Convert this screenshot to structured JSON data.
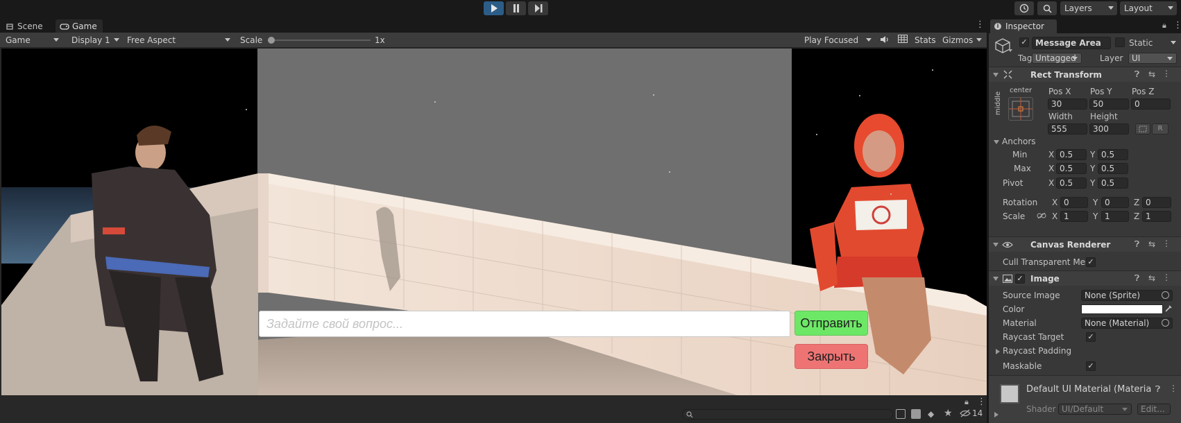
{
  "toolbar": {
    "right": {
      "history_icon": "history-icon",
      "search_icon": "search-icon",
      "layers": "Layers",
      "layout": "Layout"
    }
  },
  "game_panel": {
    "tabs": [
      {
        "label": "Scene"
      },
      {
        "label": "Game"
      }
    ],
    "toolbar": {
      "mode": "Game",
      "display": "Display 1",
      "aspect": "Free Aspect",
      "scale_label": "Scale",
      "scale_value": "1x",
      "play_focused": "Play Focused",
      "stats": "Stats",
      "gizmos": "Gizmos"
    },
    "viewport": {
      "input_placeholder": "Задайте свой вопрос...",
      "send_button": "Отправить",
      "close_button": "Закрыть"
    },
    "status": {
      "count": "14"
    }
  },
  "inspector": {
    "tab": "Inspector",
    "object": {
      "active": true,
      "name": "Message Area",
      "static_label": "Static",
      "tag_label": "Tag",
      "tag": "Untagged",
      "layer_label": "Layer",
      "layer": "UI"
    },
    "rect_transform": {
      "title": "Rect Transform",
      "anchor_h": "center",
      "anchor_v": "middle",
      "pos_x_label": "Pos X",
      "pos_y_label": "Pos Y",
      "pos_z_label": "Pos Z",
      "pos_x": "30",
      "pos_y": "50",
      "pos_z": "0",
      "width_label": "Width",
      "height_label": "Height",
      "width": "555",
      "height": "300",
      "r_button": "R",
      "anchors_label": "Anchors",
      "min_label": "Min",
      "max_label": "Max",
      "min_x": "0.5",
      "min_y": "0.5",
      "max_x": "0.5",
      "max_y": "0.5",
      "pivot_label": "Pivot",
      "pivot_x": "0.5",
      "pivot_y": "0.5",
      "rotation_label": "Rotation",
      "rot_x": "0",
      "rot_y": "0",
      "rot_z": "0",
      "scale_label": "Scale",
      "scale_x": "1",
      "scale_y": "1",
      "scale_z": "1",
      "axis_x": "X",
      "axis_y": "Y",
      "axis_z": "Z"
    },
    "canvas_renderer": {
      "title": "Canvas Renderer",
      "cull_label": "Cull Transparent Mes"
    },
    "image": {
      "title": "Image",
      "source_label": "Source Image",
      "source": "None (Sprite)",
      "color_label": "Color",
      "color": "#ffffff",
      "material_label": "Material",
      "material": "None (Material)",
      "raycast_label": "Raycast Target",
      "padding_label": "Raycast Padding",
      "maskable_label": "Maskable"
    },
    "material_footer": {
      "title": "Default UI Material (Materia",
      "shader_label": "Shader",
      "shader": "UI/Default",
      "edit": "Edit..."
    }
  },
  "colors": {
    "accent_play": "#2c5d87",
    "send_green": "#6de866",
    "close_red": "#ee7474"
  }
}
